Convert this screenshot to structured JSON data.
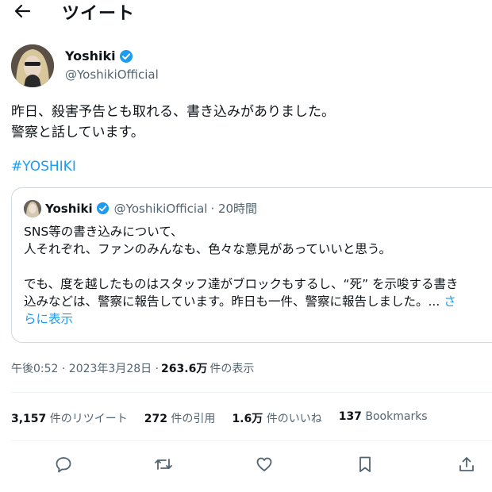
{
  "header": {
    "title": "ツイート"
  },
  "author": {
    "name": "Yoshiki",
    "handle": "@YoshikiOfficial"
  },
  "tweet": {
    "lines": [
      "昨日、殺害予告とも取れる、書き込みがありました。",
      "警察と話しています。"
    ],
    "hashtag": "#YOSHIKI"
  },
  "quote": {
    "name": "Yoshiki",
    "handle": "@YoshikiOfficial",
    "time": "· 20時間",
    "lines": [
      "SNS等の書き込みについて、",
      "人それぞれ、ファンのみんなも、色々な意見があっていいと思う。",
      "",
      "でも、度を越したものはスタッフ達がブロックもするし、“死” を示唆する書き",
      "込みなどは、警察に報告しています。昨日も一件、警察に報告しました。..."
    ],
    "more_a": "さ",
    "more_b": "らに表示"
  },
  "meta": {
    "time": "午後0:52 · 2023年3月28日 · ",
    "views": "263.6万",
    "views_label": " 件の表示"
  },
  "stats": [
    {
      "count": "3,157",
      "label": " 件のリツイート"
    },
    {
      "count": "272",
      "label": " 件の引用"
    },
    {
      "count": "1.6万",
      "label": " 件のいいね"
    },
    {
      "count": "137",
      "label": " Bookmarks"
    }
  ],
  "colors": {
    "accent": "#1d9bf0",
    "muted": "#536471",
    "text": "#0f1419",
    "border": "#cfd9de"
  },
  "icons": [
    "back-arrow-icon",
    "verified-badge-icon",
    "reply-icon",
    "retweet-icon",
    "like-icon",
    "bookmark-icon",
    "share-icon"
  ]
}
